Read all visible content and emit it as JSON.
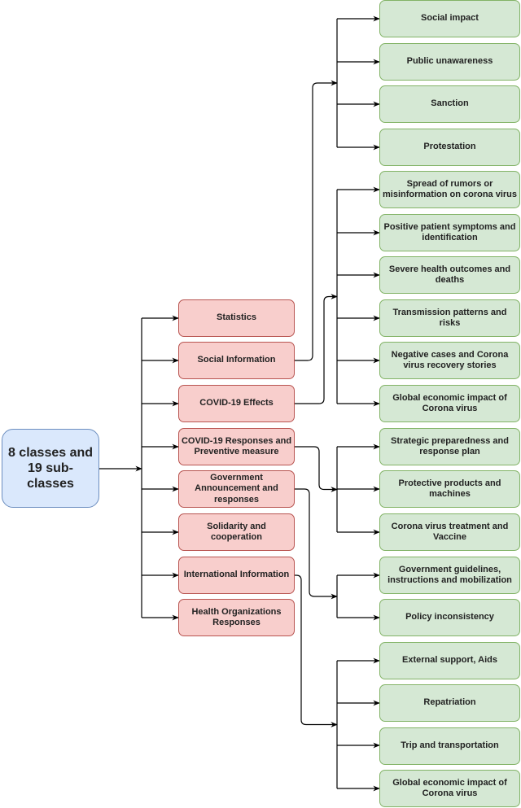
{
  "root": {
    "label": "8 classes and\n19 sub-classes",
    "line1": "8 classes and",
    "line2": "19 sub-classes"
  },
  "colors": {
    "root_fill": "#dae8fc",
    "root_stroke": "#6c8ebf",
    "class_fill": "#f8cecc",
    "class_stroke": "#b85450",
    "sub_fill": "#d5e8d4",
    "sub_stroke": "#82b366",
    "edge": "#000000"
  },
  "classes": [
    {
      "label": "Statistics",
      "children": []
    },
    {
      "label": "Social Information",
      "children": [
        0,
        1,
        2,
        3
      ]
    },
    {
      "label": "COVID-19 Effects",
      "children": [
        4,
        5,
        6,
        7,
        8,
        9
      ]
    },
    {
      "label": "COVID-19 Responses and Preventive measure",
      "children": [
        10,
        11,
        12
      ]
    },
    {
      "label": "Government Announcement and responses",
      "children": [
        13,
        14
      ]
    },
    {
      "label": "Solidarity and cooperation",
      "children": []
    },
    {
      "label": "International Information",
      "children": [
        15,
        16,
        17,
        18
      ]
    },
    {
      "label": "Health Organizations Responses",
      "children": []
    }
  ],
  "subclasses": [
    {
      "label": "Social impact"
    },
    {
      "label": "Public unawareness"
    },
    {
      "label": "Sanction"
    },
    {
      "label": "Protestation"
    },
    {
      "label": "Spread of rumors or misinformation on corona virus"
    },
    {
      "label": "Positive patient symptoms and identification"
    },
    {
      "label": "Severe health outcomes and deaths"
    },
    {
      "label": "Transmission patterns and risks"
    },
    {
      "label": "Negative cases and Corona virus recovery stories"
    },
    {
      "label": "Global economic impact of Corona virus"
    },
    {
      "label": "Strategic preparedness and response plan"
    },
    {
      "label": "Protective products and machines"
    },
    {
      "label": "Corona virus treatment and Vaccine"
    },
    {
      "label": "Government guidelines, instructions and mobilization"
    },
    {
      "label": "Policy inconsistency"
    },
    {
      "label": "External support, Aids"
    },
    {
      "label": "Repatriation"
    },
    {
      "label": "Trip and transportation"
    },
    {
      "label": "Global economic impact of Corona virus"
    }
  ]
}
